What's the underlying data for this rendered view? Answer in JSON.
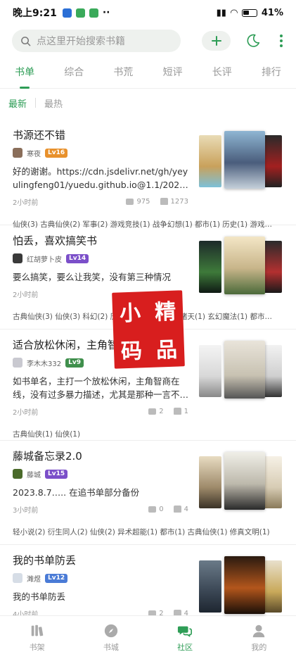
{
  "status": {
    "time": "晚上9:21",
    "more": "··",
    "battery": "41%"
  },
  "search": {
    "placeholder": "点这里开始搜索书籍"
  },
  "tabs": [
    {
      "label": "书单",
      "active": true
    },
    {
      "label": "综合"
    },
    {
      "label": "书荒"
    },
    {
      "label": "短评"
    },
    {
      "label": "长评"
    },
    {
      "label": "排行"
    }
  ],
  "sort": {
    "newest": "最新",
    "hottest": "最热"
  },
  "items": [
    {
      "title": "书源还不错",
      "author": "寒夜",
      "level": "16",
      "level_color": "#e8912c",
      "desc": "好的谢谢。https://cdn.jsdelivr.net/gh/yeyulingfeng01/yuedu.github.io@1.1/202…",
      "ago": "2小时前",
      "comments": "975",
      "likes": "1273",
      "tags": "仙侠(3) 古典仙侠(2) 军事(2) 游戏竞技(1) 战争幻想(1) 都市(1) 历史(1) 游戏…"
    },
    {
      "title": "怕丢，喜欢搞笑书",
      "author": "红胡萝卜皮",
      "level": "14",
      "level_color": "#7b4fc9",
      "desc": "要么搞笑，要么让我笑，没有第三种情况",
      "ago": "2小时前",
      "comments": "",
      "likes": "",
      "tags": "古典仙侠(3) 仙侠(3) 科幻(2) 历史(2) 现代魔法(1) 诸天(1) 玄幻魔法(1) 都市…"
    },
    {
      "title": "适合放松休闲，主角智商在线",
      "author": "李木木332",
      "level": "9",
      "level_color": "#3f8f4c",
      "desc": "如书单名，主打一个放松休闲，主角智商在线，没有过多暴力描述，尤其是那种一言不…",
      "ago": "2小时前",
      "comments": "2",
      "likes": "1",
      "tags": "古典仙侠(1) 仙侠(1)"
    },
    {
      "title": "藤城备忘录2.0",
      "author": "藤城",
      "level": "15",
      "level_color": "#7b4fc9",
      "desc": "2023.8.7….. 在追书单部分备份",
      "ago": "3小时前",
      "comments": "0",
      "likes": "4",
      "tags": "轻小说(2) 衍生同人(2) 仙侠(2) 异术超能(1) 都市(1) 古典仙侠(1) 修真文明(1)"
    },
    {
      "title": "我的书单防丢",
      "author": "濉煜",
      "level": "12",
      "level_color": "#4a7bd6",
      "desc": "我的书单防丢",
      "ago": "4小时前",
      "comments": "2",
      "likes": "4",
      "tags": ""
    }
  ],
  "watermark": [
    "小",
    "精",
    "码",
    "品"
  ],
  "nav": [
    {
      "label": "书架"
    },
    {
      "label": "书城"
    },
    {
      "label": "社区",
      "active": true
    },
    {
      "label": "我的"
    }
  ],
  "colors": {
    "accent": "#2e9d56",
    "seal": "#d81e1e"
  }
}
